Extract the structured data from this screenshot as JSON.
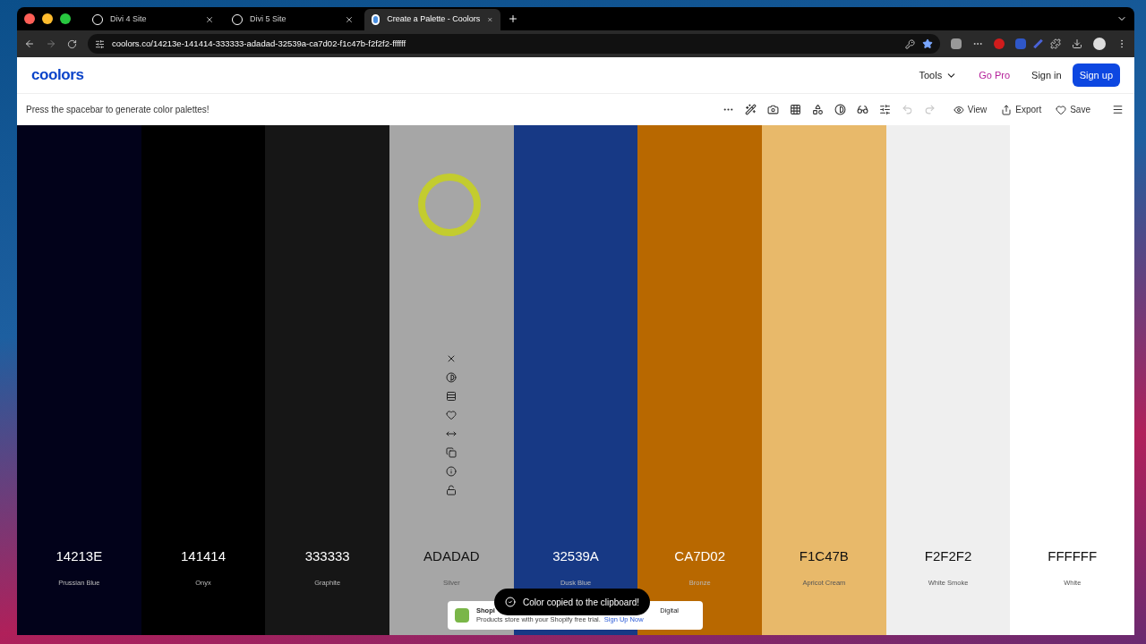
{
  "browser": {
    "tabs": [
      {
        "title": "Divi 4 Site",
        "kind": "site",
        "selected": false
      },
      {
        "title": "Divi 5 Site",
        "kind": "site",
        "selected": false
      },
      {
        "title": "Create a Palette - Coolors",
        "kind": "app",
        "selected": true
      }
    ],
    "url": "coolors.co/14213e-141414-333333-adadad-32539a-ca7d02-f1c47b-f2f2f2-ffffff"
  },
  "header": {
    "logo": "coolors",
    "nav": [
      {
        "label": "Tools",
        "kind": "menu"
      },
      {
        "label": "Go Pro",
        "kind": "pro"
      },
      {
        "label": "Sign in",
        "kind": "link"
      },
      {
        "label": "Sign up",
        "kind": "primary"
      }
    ]
  },
  "toolbar": {
    "hint": "Press the spacebar to generate color palettes!",
    "tools": [
      {
        "kind": "more",
        "disabled": false
      },
      {
        "kind": "wand",
        "disabled": false
      },
      {
        "kind": "camera",
        "disabled": false
      },
      {
        "kind": "grid",
        "disabled": false
      },
      {
        "kind": "shapes",
        "disabled": false
      },
      {
        "kind": "contrast",
        "disabled": false
      },
      {
        "kind": "glasses",
        "disabled": false
      },
      {
        "kind": "sliders",
        "disabled": false
      },
      {
        "kind": "undo",
        "disabled": true
      },
      {
        "kind": "redo",
        "disabled": true
      }
    ],
    "actions": [
      {
        "kind": "view",
        "label": "View"
      },
      {
        "kind": "export",
        "label": "Export"
      },
      {
        "kind": "save",
        "label": "Save"
      }
    ]
  },
  "palette": [
    {
      "hex": "14213E",
      "name": "Prussian Blue",
      "color": "#02021a",
      "hovered": false
    },
    {
      "hex": "141414",
      "name": "Onyx",
      "color": "#000000",
      "hovered": false
    },
    {
      "hex": "333333",
      "name": "Graphite",
      "color": "#161616",
      "hovered": false
    },
    {
      "hex": "ADADAD",
      "name": "Silver",
      "color": "#a6a6a6",
      "hovered": true
    },
    {
      "hex": "32539A",
      "name": "Dusk Blue",
      "color": "#173985",
      "hovered": false
    },
    {
      "hex": "CA7D02",
      "name": "Bronze",
      "color": "#b86800",
      "hovered": false
    },
    {
      "hex": "F1C47B",
      "name": "Apricot Cream",
      "color": "#e8b96a",
      "hovered": false
    },
    {
      "hex": "F2F2F2",
      "name": "White Smoke",
      "color": "#efefef",
      "hovered": false
    },
    {
      "hex": "FFFFFF",
      "name": "White",
      "color": "#ffffff",
      "hovered": false
    }
  ],
  "ad": {
    "title": "Shopi",
    "title_end": "Digital",
    "body": "Products store with your Shopify free trial.",
    "link": "Sign Up Now"
  },
  "toast": {
    "message": "Color copied to the clipboard!"
  }
}
